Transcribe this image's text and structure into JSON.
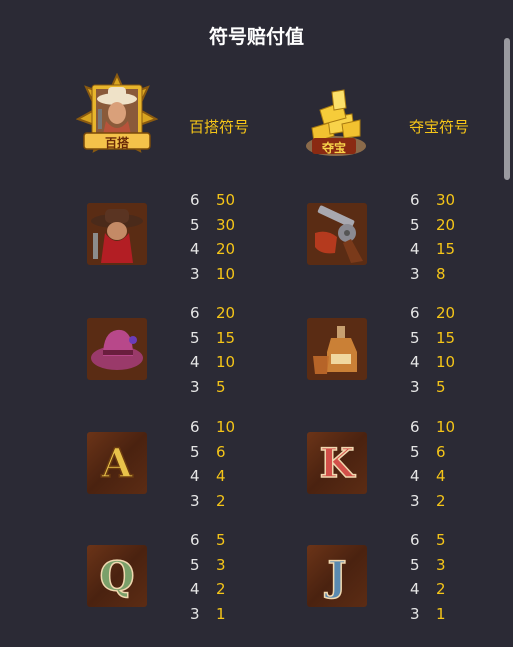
{
  "title": "符号赔付值",
  "wild": {
    "label": "百搭符号",
    "badge": "百搭"
  },
  "scatter": {
    "label": "夺宝符号",
    "badge": "夺宝"
  },
  "symbols": [
    {
      "name": "bandit",
      "icon": "bandit-icon",
      "pays": [
        {
          "count": "6",
          "value": "50"
        },
        {
          "count": "5",
          "value": "30"
        },
        {
          "count": "4",
          "value": "20"
        },
        {
          "count": "3",
          "value": "10"
        }
      ]
    },
    {
      "name": "revolver",
      "icon": "revolver-icon",
      "pays": [
        {
          "count": "6",
          "value": "30"
        },
        {
          "count": "5",
          "value": "20"
        },
        {
          "count": "4",
          "value": "15"
        },
        {
          "count": "3",
          "value": "8"
        }
      ]
    },
    {
      "name": "cowboy-hat",
      "icon": "cowboy-hat-icon",
      "pays": [
        {
          "count": "6",
          "value": "20"
        },
        {
          "count": "5",
          "value": "15"
        },
        {
          "count": "4",
          "value": "10"
        },
        {
          "count": "3",
          "value": "5"
        }
      ]
    },
    {
      "name": "whiskey",
      "icon": "whiskey-icon",
      "pays": [
        {
          "count": "6",
          "value": "20"
        },
        {
          "count": "5",
          "value": "15"
        },
        {
          "count": "4",
          "value": "10"
        },
        {
          "count": "3",
          "value": "5"
        }
      ]
    },
    {
      "name": "A",
      "icon": "letter-a-icon",
      "letter": "A",
      "pays": [
        {
          "count": "6",
          "value": "10"
        },
        {
          "count": "5",
          "value": "6"
        },
        {
          "count": "4",
          "value": "4"
        },
        {
          "count": "3",
          "value": "2"
        }
      ]
    },
    {
      "name": "K",
      "icon": "letter-k-icon",
      "letter": "K",
      "pays": [
        {
          "count": "6",
          "value": "10"
        },
        {
          "count": "5",
          "value": "6"
        },
        {
          "count": "4",
          "value": "4"
        },
        {
          "count": "3",
          "value": "2"
        }
      ]
    },
    {
      "name": "Q",
      "icon": "letter-q-icon",
      "letter": "Q",
      "pays": [
        {
          "count": "6",
          "value": "5"
        },
        {
          "count": "5",
          "value": "3"
        },
        {
          "count": "4",
          "value": "2"
        },
        {
          "count": "3",
          "value": "1"
        }
      ]
    },
    {
      "name": "J",
      "icon": "letter-j-icon",
      "letter": "J",
      "pays": [
        {
          "count": "6",
          "value": "5"
        },
        {
          "count": "5",
          "value": "3"
        },
        {
          "count": "4",
          "value": "2"
        },
        {
          "count": "3",
          "value": "1"
        }
      ]
    }
  ],
  "colors": {
    "background": "#2b2a35",
    "value": "#f5c518",
    "count": "#e6e6e6"
  }
}
